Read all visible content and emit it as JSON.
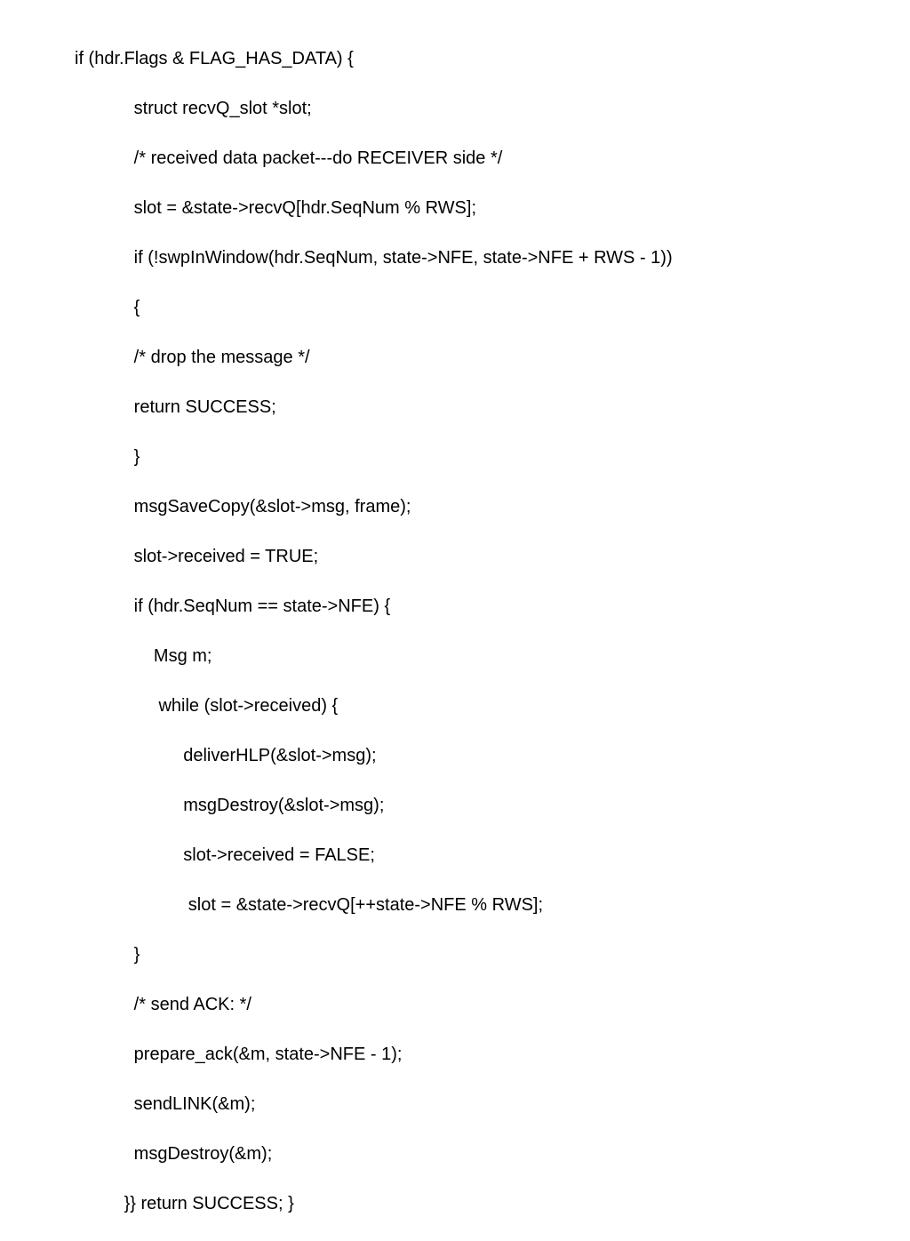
{
  "code": {
    "lines": [
      "if (hdr.Flags & FLAG_HAS_DATA) {",
      "            struct recvQ_slot *slot;",
      "            /* received data packet---do RECEIVER side */",
      "            slot = &state->recvQ[hdr.SeqNum % RWS];",
      "            if (!swpInWindow(hdr.SeqNum, state->NFE, state->NFE + RWS - 1))",
      "            {",
      "            /* drop the message */",
      "            return SUCCESS;",
      "            }",
      "            msgSaveCopy(&slot->msg, frame);",
      "            slot->received = TRUE;",
      "            if (hdr.SeqNum == state->NFE) {",
      "                Msg m;",
      "                 while (slot->received) {",
      "                      deliverHLP(&slot->msg);",
      "                      msgDestroy(&slot->msg);",
      "                      slot->received = FALSE;",
      "                       slot = &state->recvQ[++state->NFE % RWS];",
      "            }",
      "            /* send ACK: */",
      "            prepare_ack(&m, state->NFE - 1);",
      "            sendLINK(&m);",
      "            msgDestroy(&m);",
      "          }} return SUCCESS; }"
    ]
  }
}
